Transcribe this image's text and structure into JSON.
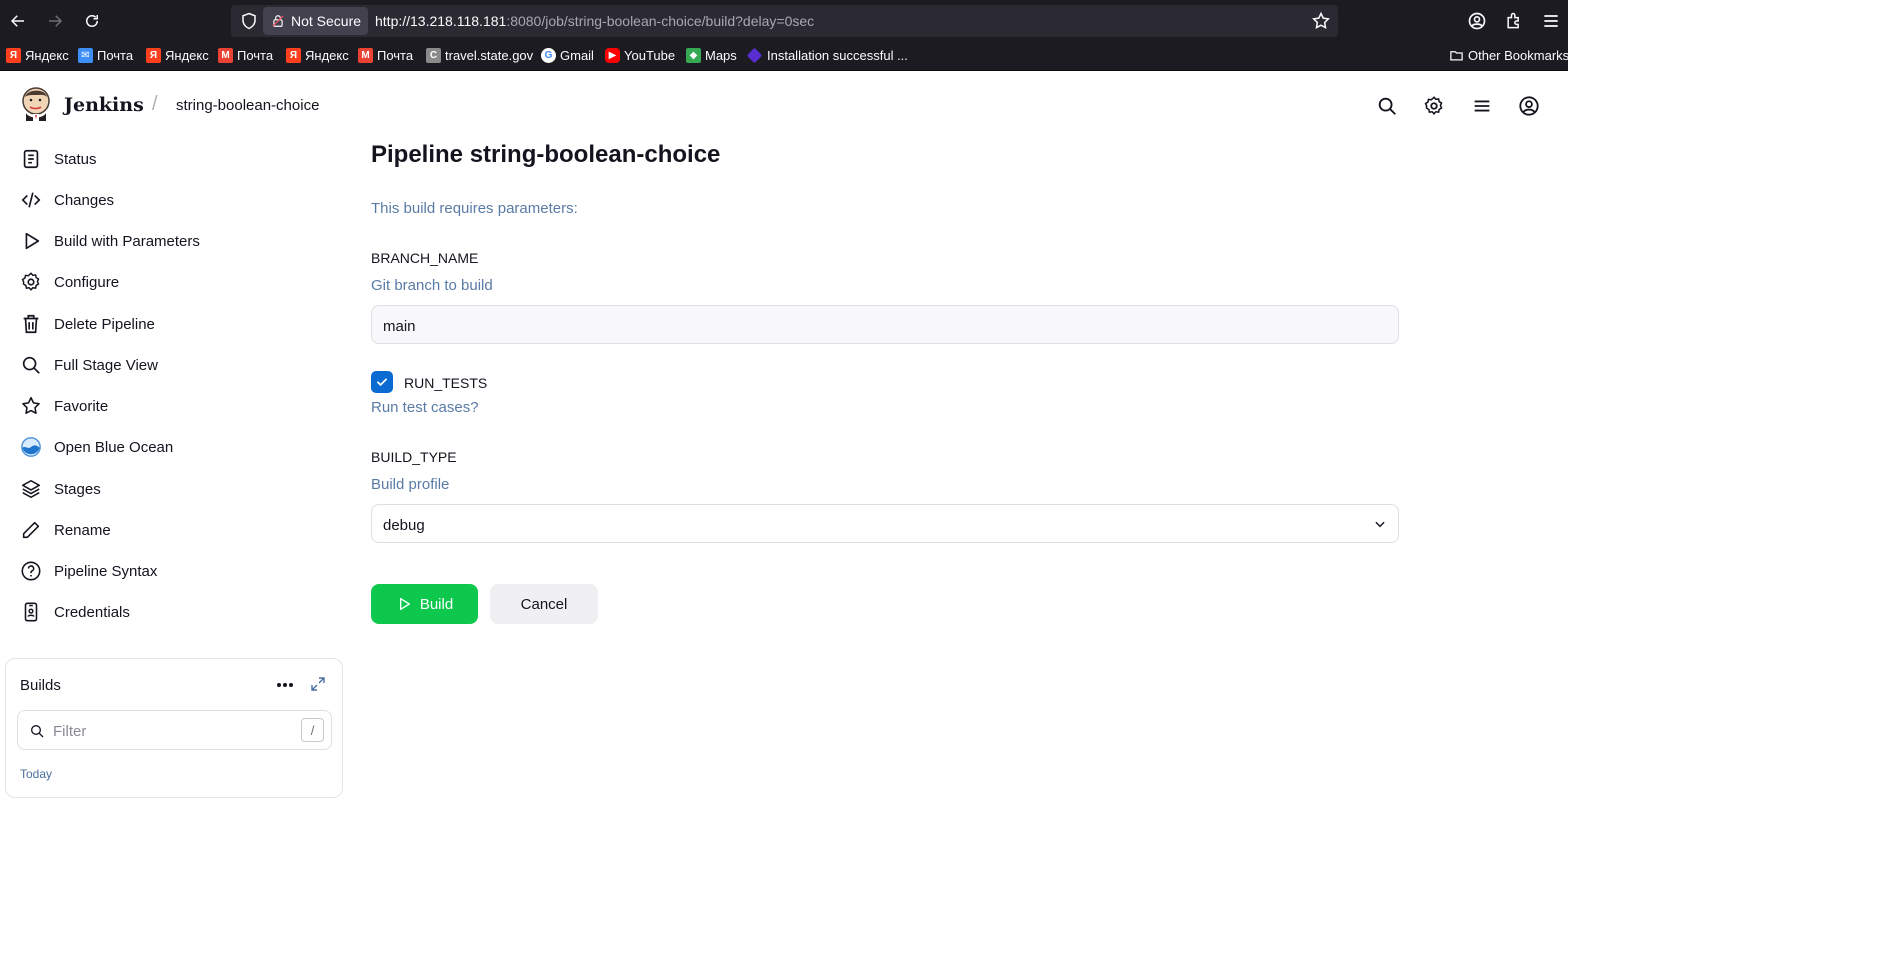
{
  "browser": {
    "security_label": "Not Secure",
    "url_host": "http://13.218.118.181",
    "url_rest": ":8080/job/string-boolean-choice/build?delay=0sec",
    "bookmarks": [
      {
        "label": "Яндекс",
        "icon": "yandex-icon"
      },
      {
        "label": "Почта",
        "icon": "mail-icon"
      },
      {
        "label": "Яндекс",
        "icon": "yandex-icon"
      },
      {
        "label": "Почта",
        "icon": "gmail-icon"
      },
      {
        "label": "Яндекс",
        "icon": "yandex-icon"
      },
      {
        "label": "Почта",
        "icon": "gmail-icon"
      },
      {
        "label": "travel.state.gov",
        "icon": "travel-icon"
      },
      {
        "label": "Gmail",
        "icon": "google-icon"
      },
      {
        "label": "YouTube",
        "icon": "youtube-icon"
      },
      {
        "label": "Maps",
        "icon": "maps-icon"
      },
      {
        "label": "Installation successful ...",
        "icon": "install-icon"
      }
    ],
    "other_bookmarks": "Other Bookmarks"
  },
  "header": {
    "brand": "Jenkins",
    "breadcrumb": "string-boolean-choice"
  },
  "sidebar": {
    "items": [
      {
        "label": "Status",
        "icon": "status-icon"
      },
      {
        "label": "Changes",
        "icon": "code-icon"
      },
      {
        "label": "Build with Parameters",
        "icon": "play-icon"
      },
      {
        "label": "Configure",
        "icon": "gear-icon"
      },
      {
        "label": "Delete Pipeline",
        "icon": "trash-icon"
      },
      {
        "label": "Full Stage View",
        "icon": "search-icon"
      },
      {
        "label": "Favorite",
        "icon": "star-icon"
      },
      {
        "label": "Open Blue Ocean",
        "icon": "blue-ocean-icon"
      },
      {
        "label": "Stages",
        "icon": "layers-icon"
      },
      {
        "label": "Rename",
        "icon": "pencil-icon"
      },
      {
        "label": "Pipeline Syntax",
        "icon": "help-icon"
      },
      {
        "label": "Credentials",
        "icon": "credentials-icon"
      }
    ]
  },
  "builds": {
    "title": "Builds",
    "filter_placeholder": "Filter",
    "shortcut": "/",
    "group_label": "Today"
  },
  "main": {
    "title": "Pipeline string-boolean-choice",
    "requires_text": "This build requires parameters:",
    "params": {
      "branch": {
        "name": "BRANCH_NAME",
        "description": "Git branch to build",
        "value": "main"
      },
      "run_tests": {
        "name": "RUN_TESTS",
        "description": "Run test cases?",
        "checked": true
      },
      "build_type": {
        "name": "BUILD_TYPE",
        "description": "Build profile",
        "value": "debug"
      }
    },
    "build_button": "Build",
    "cancel_button": "Cancel"
  },
  "colors": {
    "accent_blue": "#0b6bd3",
    "build_green": "#0ec84e",
    "description_text": "#5a7ba6"
  }
}
